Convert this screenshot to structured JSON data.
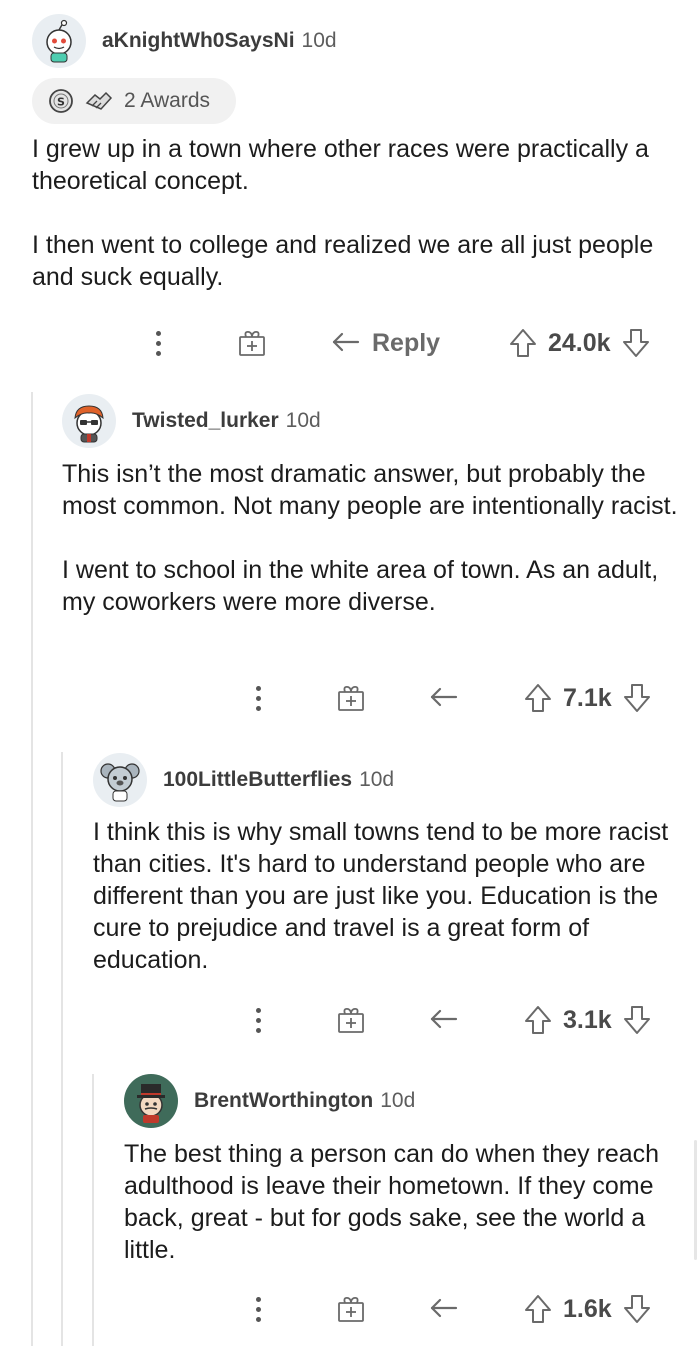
{
  "colors": {
    "text": "#1c1c1c",
    "meta": "#5d5d5d",
    "icon": "#6a6a6a",
    "thread_line": "#e4e4e4",
    "award_pill": "#f1f1f1"
  },
  "comments": [
    {
      "username": "aKnightWh0SaysNi",
      "age": "10d",
      "avatar": "snoo-teal-avatar",
      "awards_label": "2 Awards",
      "paragraphs": [
        "I grew up in a town where other races were practically a theoretical concept.",
        "I then went to college and realized we are all just people and suck equally."
      ],
      "reply_label": "Reply",
      "score": "24.0k"
    },
    {
      "username": "Twisted_lurker",
      "age": "10d",
      "avatar": "snoo-redhead-glasses-avatar",
      "paragraphs": [
        "This isn’t the most dramatic answer, but probably the most common. Not many people are intentionally racist.",
        "I went to school in the white area of town. As an adult, my coworkers were more diverse."
      ],
      "score": "7.1k"
    },
    {
      "username": "100LittleButterflies",
      "age": "10d",
      "avatar": "snoo-koala-avatar",
      "paragraphs": [
        "I think this is why small towns tend to be more racist than cities. It's hard to understand people who are different than you are just like you. Education is the cure to prejudice and travel is a great form of education."
      ],
      "score": "3.1k"
    },
    {
      "username": "BrentWorthington",
      "age": "10d",
      "avatar": "snoo-tophat-avatar",
      "paragraphs": [
        "The best thing a person can do when they reach adulthood is leave their hometown. If they come back, great - but for gods sake, see the world a little."
      ],
      "score": "1.6k"
    }
  ]
}
